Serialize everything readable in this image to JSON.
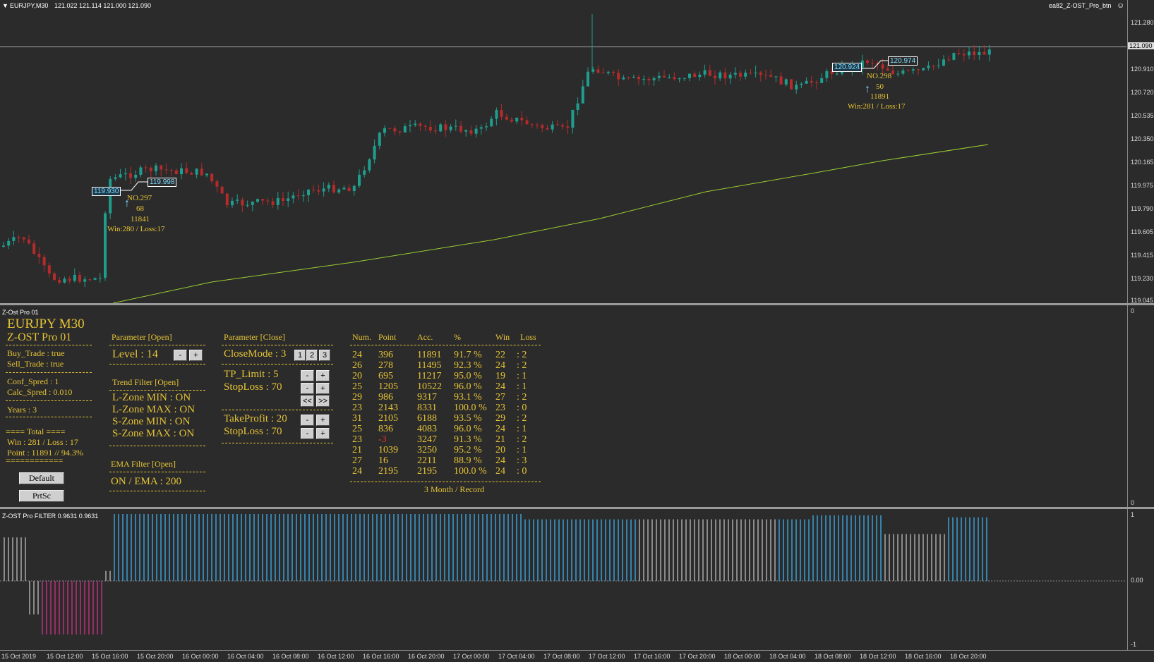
{
  "chart_header": {
    "symbol_title": "EURJPY,M30",
    "ohlc": "121.022 121.114 121.000 121.090",
    "ea_name": "ea82_Z-OST_Pro_btn"
  },
  "price_axis": [
    "121.280",
    "121.090",
    "120.910",
    "120.720",
    "120.535",
    "120.350",
    "120.165",
    "119.975",
    "119.790",
    "119.605",
    "119.415",
    "119.230",
    "119.045"
  ],
  "current_price": "121.090",
  "annotations": {
    "a1": {
      "box_left": "119.930",
      "box_right": "119.998",
      "no": "NO.297",
      "pts": "68",
      "acc": "11841",
      "stat": "Win:280 / Loss:17"
    },
    "a2": {
      "box_left": "120.924",
      "box_right": "120.974",
      "no": "NO.298",
      "pts": "50",
      "acc": "11891",
      "stat": "Win:281 / Loss:17"
    }
  },
  "indicator_window": {
    "title": "Z-Ost Pro 01",
    "axis_top": "0",
    "axis_bottom": "0"
  },
  "panel": {
    "pair": "EURJPY M30",
    "product": "Z-OST Pro 01",
    "buy_trade": "Buy_Trade : true",
    "sell_trade": "Sell_Trade : true",
    "conf_spred": "Conf_Spred : 1",
    "calc_spred": "Calc_Spred : 0.010",
    "years": "Years : 3",
    "total": "==== Total ====",
    "win_loss": "Win : 281 / Loss : 17",
    "point": "Point : 11891 // 94.3%",
    "equals": "============",
    "default_btn": "Default",
    "prtsc_btn": "PrtSc",
    "param_open": "Parameter [Open]",
    "level": "Level : 14",
    "trend_filter": "Trend Filter [Open]",
    "lzone_min": "L-Zone MIN : ON",
    "lzone_max": "L-Zone MAX : ON",
    "szone_min": "S-Zone MIN : ON",
    "szone_max": "S-Zone MAX : ON",
    "ema_filter": "EMA Filter [Open]",
    "ema_on": "ON / EMA : 200",
    "param_close": "Parameter [Close]",
    "close_mode": "CloseMode : 3",
    "close_opts": [
      "1",
      "2",
      "3"
    ],
    "tp_limit": "TP_Limit : 5",
    "stoploss1": "StopLoss : 70",
    "takeprofit": "TakeProfit : 20",
    "stoploss2": "StopLoss : 70",
    "minus": "-",
    "plus": "+",
    "prev": "<<",
    "next": ">>",
    "record_caption": "3 Month / Record"
  },
  "record_table": {
    "headers": [
      "Num.",
      "Point",
      "Acc.",
      "%",
      "Win",
      "Loss"
    ],
    "rows": [
      [
        "24",
        "396",
        "11891",
        "91.7 %",
        "22",
        ": 2"
      ],
      [
        "26",
        "278",
        "11495",
        "92.3 %",
        "24",
        ": 2"
      ],
      [
        "20",
        "695",
        "11217",
        "95.0 %",
        "19",
        ": 1"
      ],
      [
        "25",
        "1205",
        "10522",
        "96.0 %",
        "24",
        ": 1"
      ],
      [
        "29",
        "986",
        "9317",
        "93.1 %",
        "27",
        ": 2"
      ],
      [
        "23",
        "2143",
        "8331",
        "100.0 %",
        "23",
        ": 0"
      ],
      [
        "31",
        "2105",
        "6188",
        "93.5 %",
        "29",
        ": 2"
      ],
      [
        "25",
        "836",
        "4083",
        "96.0 %",
        "24",
        ": 1"
      ],
      [
        "23",
        "-3",
        "3247",
        "91.3 %",
        "21",
        ": 2"
      ],
      [
        "21",
        "1039",
        "3250",
        "95.2 %",
        "20",
        ": 1"
      ],
      [
        "27",
        "16",
        "2211",
        "88.9 %",
        "24",
        ": 3"
      ],
      [
        "24",
        "2195",
        "2195",
        "100.0 %",
        "24",
        ": 0"
      ]
    ]
  },
  "filter_window": {
    "title": "Z-OST Pro FILTER 0.9631 0.9631",
    "axis_top": "1",
    "axis_mid": "0.00",
    "axis_bottom": "-1"
  },
  "time_axis": [
    "15 Oct 2019",
    "15 Oct 12:00",
    "15 Oct 16:00",
    "15 Oct 20:00",
    "16 Oct 00:00",
    "16 Oct 04:00",
    "16 Oct 08:00",
    "16 Oct 12:00",
    "16 Oct 16:00",
    "16 Oct 20:00",
    "17 Oct 00:00",
    "17 Oct 04:00",
    "17 Oct 08:00",
    "17 Oct 12:00",
    "17 Oct 16:00",
    "17 Oct 20:00",
    "18 Oct 00:00",
    "18 Oct 04:00",
    "18 Oct 08:00",
    "18 Oct 12:00",
    "18 Oct 16:00",
    "18 Oct 20:00"
  ],
  "colors": {
    "bull": "#1e9e8e",
    "bear": "#b52b2b",
    "ema": "#9acd32",
    "gold": "#e6c436",
    "filter_pos": "#3aa0d8",
    "filter_neg": "#c0307a",
    "filter_neutral": "#aaaaaa"
  }
}
